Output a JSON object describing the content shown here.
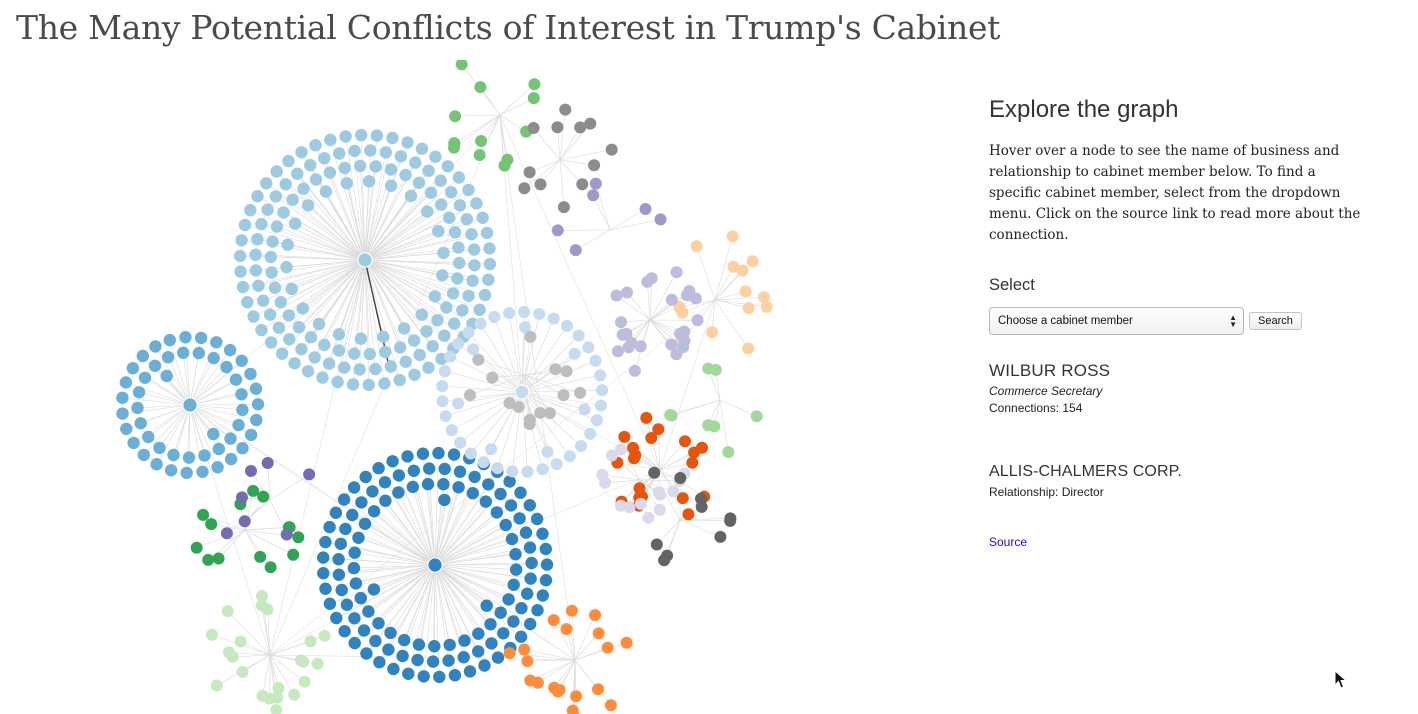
{
  "page": {
    "title": "The Many Potential Conflicts of Interest in Trump's Cabinet"
  },
  "panel": {
    "heading": "Explore the graph",
    "intro": "Hover over a node to see the name of business and relationship to cabinet member below. To find a specific cabinet member, select from the dropdown menu. Click on the source link to read more about the connection.",
    "select_label": "Select",
    "select_value": "Choose a cabinet member",
    "search_label": "Search",
    "member": {
      "name": "WILBUR ROSS",
      "title": "Commerce Secretary",
      "connections": "Connections: 154"
    },
    "business": {
      "name": "ALLIS-CHALMERS CORP.",
      "relationship": "Relationship: Director"
    },
    "source_label": "Source"
  },
  "graph": {
    "link_color": "#d9d9d9",
    "highlight_link_color": "#444444",
    "clusters": [
      {
        "color": "#9ecae1",
        "count": 154
      },
      {
        "color": "#3182bd",
        "count": 120
      },
      {
        "color": "#6baed6",
        "count": 50
      },
      {
        "color": "#c6dbef",
        "count": 40
      },
      {
        "color": "#bdbdbd",
        "count": 14
      },
      {
        "color": "#74c476",
        "count": 12
      },
      {
        "color": "#8c8c8c",
        "count": 12
      },
      {
        "color": "#fdd0a2",
        "count": 14
      },
      {
        "color": "#bcbddc",
        "count": 24
      },
      {
        "color": "#9e9ac8",
        "count": 6
      },
      {
        "color": "#31a354",
        "count": 14
      },
      {
        "color": "#756bb1",
        "count": 7
      },
      {
        "color": "#c7e9c0",
        "count": 22
      },
      {
        "color": "#e6550d",
        "count": 20
      },
      {
        "color": "#dadaeb",
        "count": 14
      },
      {
        "color": "#636363",
        "count": 10
      },
      {
        "color": "#fd8d3c",
        "count": 22
      },
      {
        "color": "#a1d99b",
        "count": 8
      }
    ]
  }
}
